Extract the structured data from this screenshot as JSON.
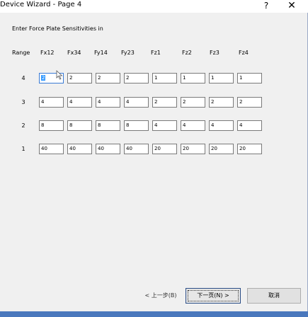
{
  "window": {
    "title": "Device Wizard - Page 4",
    "help_glyph": "?",
    "close_glyph": "✕"
  },
  "instruction": "Enter Force Plate Sensitivities in",
  "table": {
    "headers": [
      "Range",
      "Fx12",
      "Fx34",
      "Fy14",
      "Fy23",
      "Fz1",
      "Fz2",
      "Fz3",
      "Fz4"
    ],
    "rows": [
      {
        "range": "4",
        "values": [
          "2",
          "2",
          "2",
          "2",
          "1",
          "1",
          "1",
          "1"
        ]
      },
      {
        "range": "3",
        "values": [
          "4",
          "4",
          "4",
          "4",
          "2",
          "2",
          "2",
          "2"
        ]
      },
      {
        "range": "2",
        "values": [
          "8",
          "8",
          "8",
          "8",
          "4",
          "4",
          "4",
          "4"
        ]
      },
      {
        "range": "1",
        "values": [
          "40",
          "40",
          "40",
          "40",
          "20",
          "20",
          "20",
          "20"
        ]
      }
    ]
  },
  "buttons": {
    "back": "< 上一步(B)",
    "next": "下一页(N) >",
    "cancel": "取消"
  },
  "colors": {
    "selection": "#3399ff",
    "taskbar": "#4a78bd"
  }
}
